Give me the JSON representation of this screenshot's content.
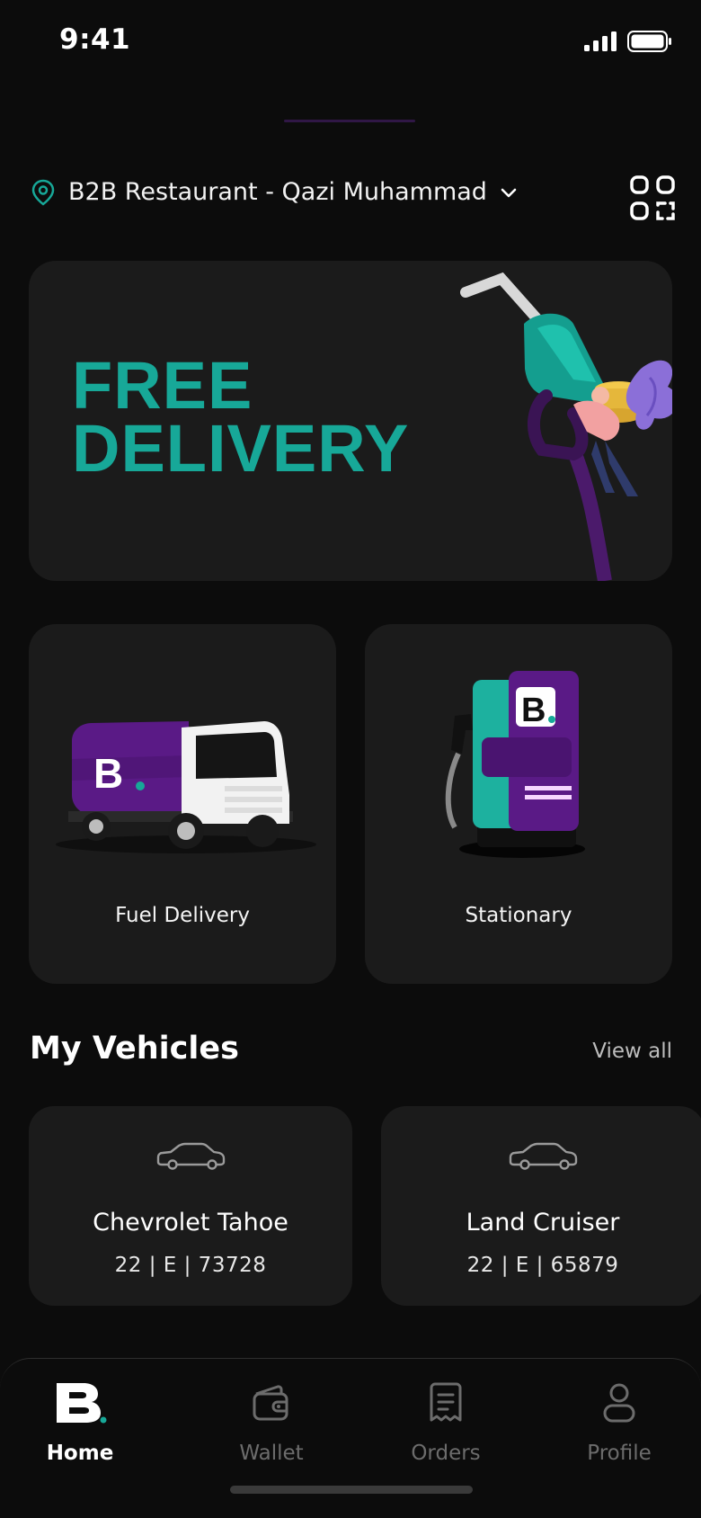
{
  "status_bar": {
    "time": "9:41"
  },
  "location": {
    "label": "B2B Restaurant - Qazi Muhammad"
  },
  "banner": {
    "line1": "FREE",
    "line2": "DELIVERY"
  },
  "services": [
    {
      "label": "Fuel Delivery"
    },
    {
      "label": "Stationary"
    }
  ],
  "vehicles_section": {
    "title": "My Vehicles",
    "view_all": "View all"
  },
  "vehicles": [
    {
      "name": "Chevrolet Tahoe",
      "plate": "22 | E | 73728"
    },
    {
      "name": "Land Cruiser",
      "plate": "22 | E | 65879"
    }
  ],
  "nav": [
    {
      "label": "Home",
      "icon": "brand-b-icon",
      "active": true
    },
    {
      "label": "Wallet",
      "icon": "wallet-icon",
      "active": false
    },
    {
      "label": "Orders",
      "icon": "receipt-icon",
      "active": false
    },
    {
      "label": "Profile",
      "icon": "person-icon",
      "active": false
    }
  ],
  "colors": {
    "accent": "#17a898",
    "brand_purple": "#5a1a86",
    "card": "#1b1b1b",
    "background": "#0c0c0c"
  }
}
